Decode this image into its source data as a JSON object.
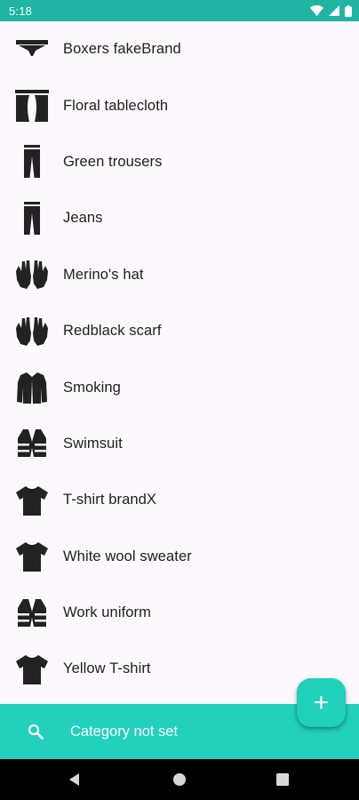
{
  "status_bar": {
    "time": "5:18",
    "icons": [
      "wifi-icon",
      "signal-icon",
      "battery-icon"
    ]
  },
  "items": [
    {
      "label": "Boxers fakeBrand",
      "icon": "underwear-icon"
    },
    {
      "label": "Floral tablecloth",
      "icon": "curtains-icon"
    },
    {
      "label": "Green trousers",
      "icon": "trousers-icon"
    },
    {
      "label": "Jeans",
      "icon": "trousers-icon"
    },
    {
      "label": "Merino's hat",
      "icon": "gloves-icon"
    },
    {
      "label": "Redblack scarf",
      "icon": "gloves-icon"
    },
    {
      "label": "Smoking",
      "icon": "suit-jacket-icon"
    },
    {
      "label": "Swimsuit",
      "icon": "vest-icon"
    },
    {
      "label": "T-shirt brandX",
      "icon": "tshirt-icon"
    },
    {
      "label": "White wool sweater",
      "icon": "tshirt-icon"
    },
    {
      "label": "Work uniform",
      "icon": "vest-icon"
    },
    {
      "label": "Yellow T-shirt",
      "icon": "tshirt-icon"
    }
  ],
  "fab": {
    "icon": "plus-icon",
    "label": "+"
  },
  "filter_bar": {
    "icon": "search-icon",
    "label": "Category not set"
  },
  "nav_bar": {
    "icons": [
      "back-icon",
      "home-icon",
      "recents-icon"
    ]
  },
  "colors": {
    "status_bar": "#1fb5a2",
    "filter_bar": "#22d1bd",
    "fab": "#1fd1b8",
    "background": "#fdf8fd",
    "icon": "#222222",
    "text": "#202020"
  }
}
